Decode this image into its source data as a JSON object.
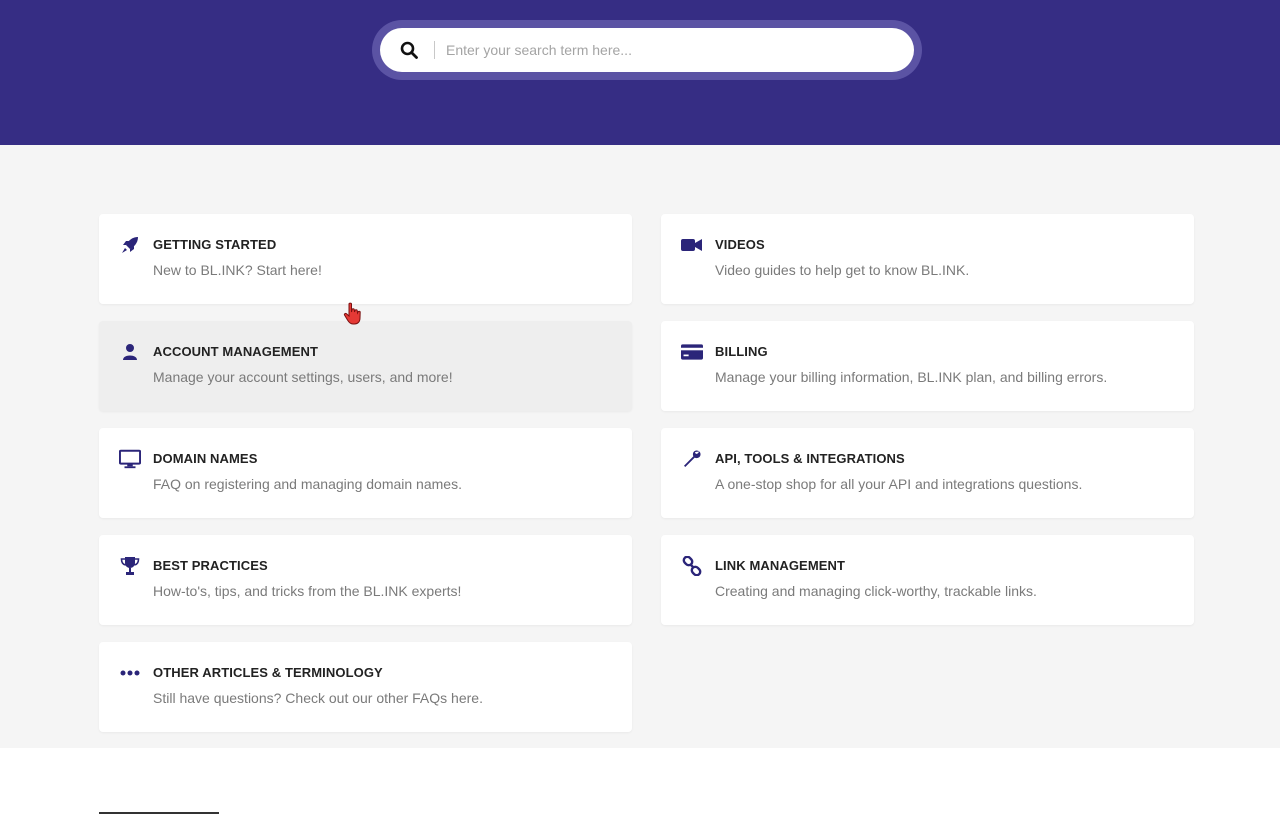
{
  "search": {
    "placeholder": "Enter your search term here..."
  },
  "colors": {
    "hero_bg": "#362d84",
    "accent": "#2b2579",
    "page_bg": "#f5f5f5",
    "card_bg": "#ffffff",
    "card_hover_bg": "#eeeeee"
  },
  "categories": [
    {
      "icon": "rocket-icon",
      "title": "GETTING STARTED",
      "desc": "New to BL.INK? Start here!"
    },
    {
      "icon": "video-camera-icon",
      "title": "VIDEOS",
      "desc": "Video guides to help get to know BL.INK."
    },
    {
      "icon": "user-icon",
      "title": "ACCOUNT MANAGEMENT",
      "desc": "Manage your account settings, users, and more!"
    },
    {
      "icon": "credit-card-icon",
      "title": "BILLING",
      "desc": "Manage your billing information, BL.INK plan, and billing errors."
    },
    {
      "icon": "monitor-icon",
      "title": "DOMAIN NAMES",
      "desc": "FAQ on registering and managing domain names."
    },
    {
      "icon": "wrench-icon",
      "title": "API, TOOLS & INTEGRATIONS",
      "desc": "A one-stop shop for all your API and integrations questions."
    },
    {
      "icon": "trophy-icon",
      "title": "BEST PRACTICES",
      "desc": "How-to's, tips, and tricks from the BL.INK experts!"
    },
    {
      "icon": "link-icon",
      "title": "LINK MANAGEMENT",
      "desc": "Creating and managing click-worthy, trackable links."
    },
    {
      "icon": "ellipsis-icon",
      "title": "OTHER ARTICLES & TERMINOLOGY",
      "desc": "Still have questions? Check out our other FAQs here."
    }
  ]
}
